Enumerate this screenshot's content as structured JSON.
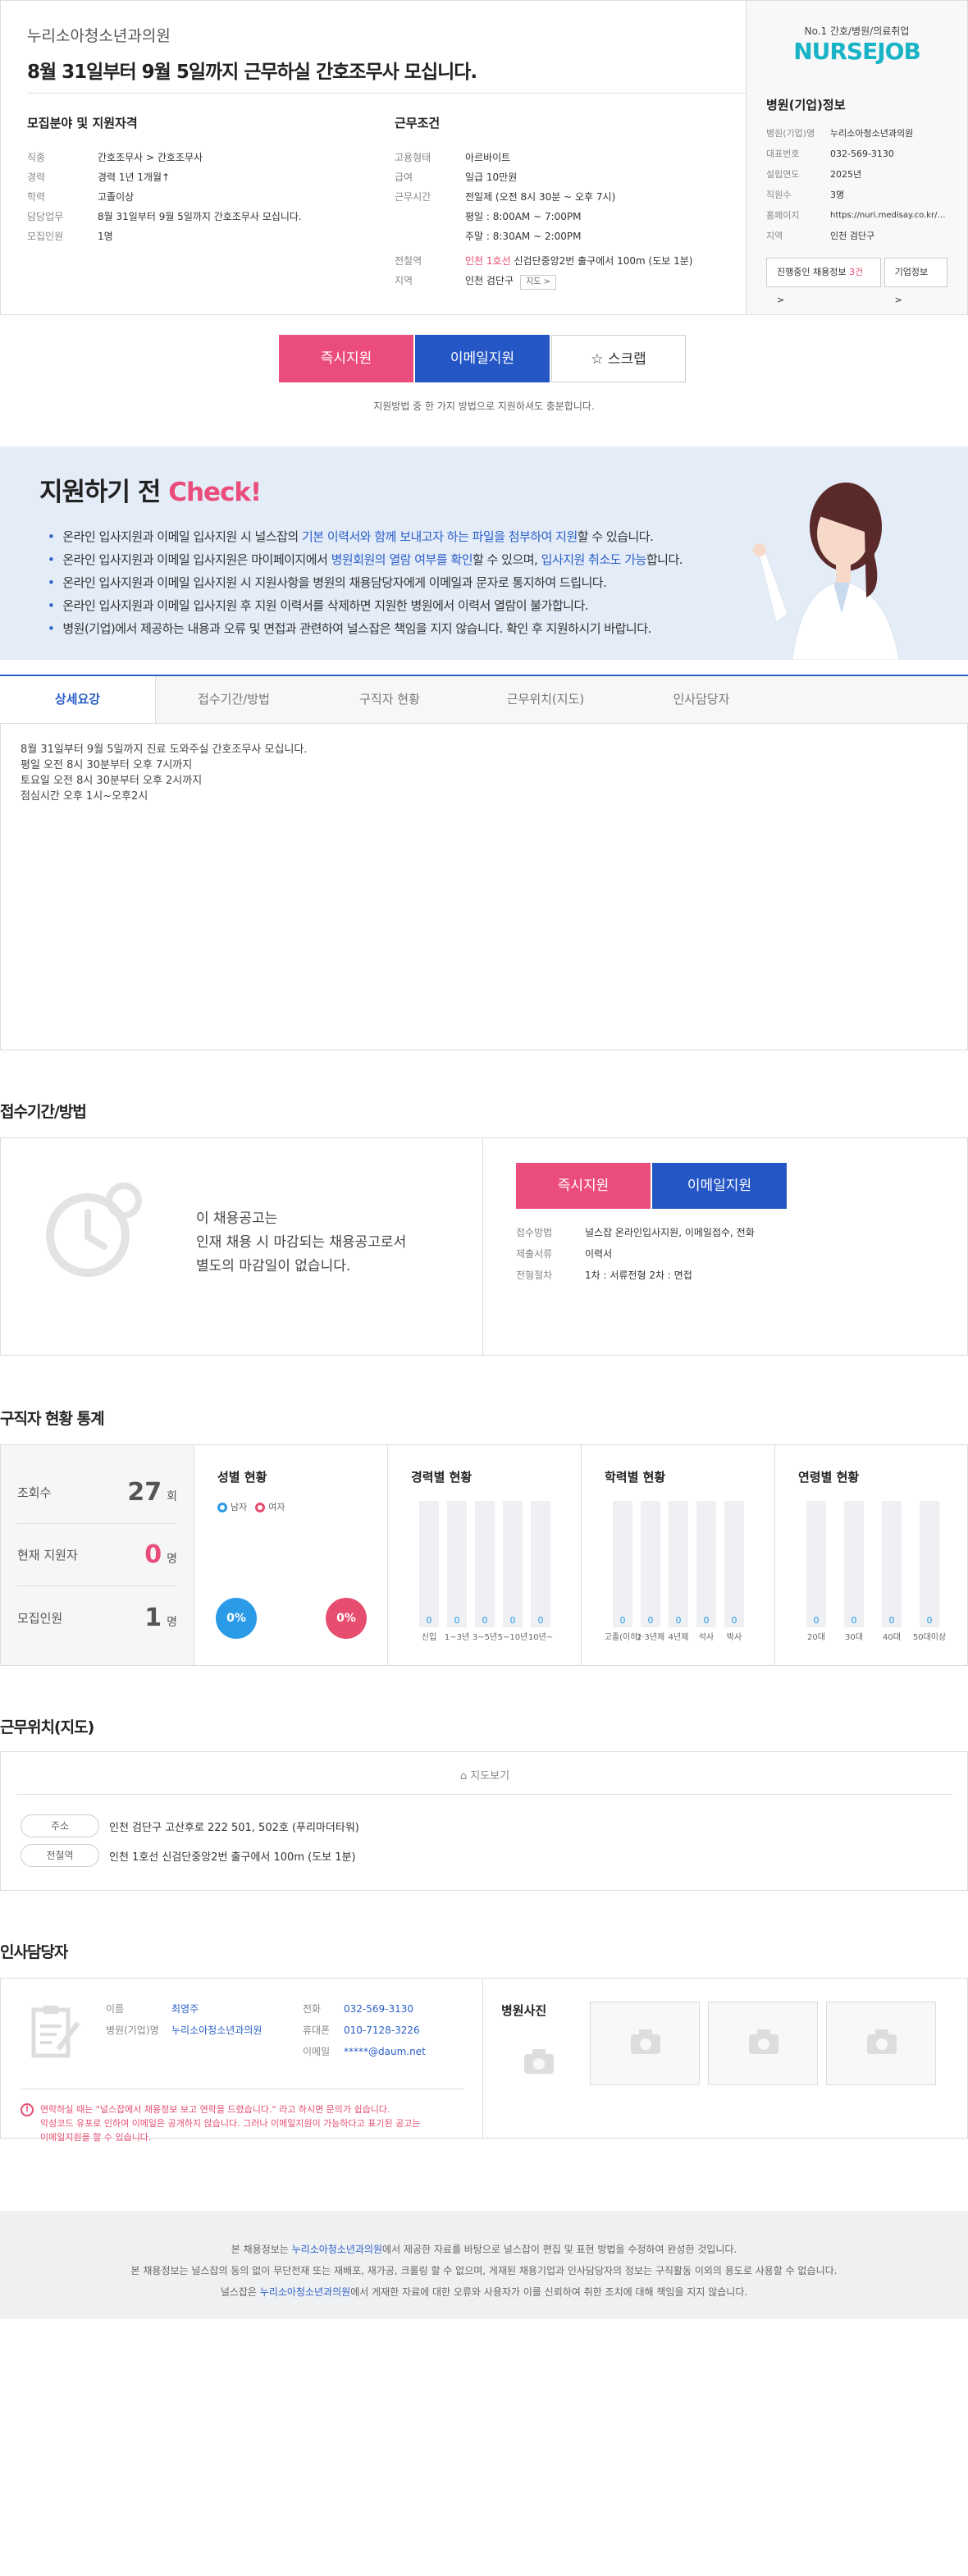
{
  "header": {
    "company": "누리소아청소년과의원",
    "title": "8월 31일부터 9월 5일까지 근무하실 간호조무사 모십니다.",
    "field_heading": "모집분야 및 지원자격",
    "field_rows": [
      {
        "k": "직종",
        "v": "간호조무사 > 간호조무사"
      },
      {
        "k": "경력",
        "v": "경력 1년 1개월↑"
      },
      {
        "k": "학력",
        "v": "고졸이상"
      },
      {
        "k": "담당업무",
        "v": "8월 31일부터 9월 5일까지 간호조무사 모십니다."
      },
      {
        "k": "모집인원",
        "v": "1명"
      }
    ],
    "cond_heading": "근무조건",
    "cond_rows": {
      "type_k": "고용형태",
      "type_v": "아르바이트",
      "pay_k": "급여",
      "pay_v": "일급 10만원",
      "time_k": "근무시간",
      "time_v1": "전일제 (오전 8시 30분 ~ 오후 7시)",
      "time_v2": "평일 : 8:00AM ~ 7:00PM",
      "time_v3": "주말 : 8:30AM ~ 2:00PM",
      "sub_k": "전철역",
      "sub_line": "인천 1호선",
      "sub_v": "신검단중앙2번 출구에서 100m (도보 1분)",
      "area_k": "지역",
      "area_v": "인천 검단구",
      "map_btn": "지도 >"
    }
  },
  "side": {
    "brand_sub": "No.1 간호/병원/의료취업",
    "brand": "NURSEJOB",
    "heading": "병원(기업)정보",
    "rows": [
      {
        "k": "병원(기업)명",
        "v": "누리소아청소년과의원"
      },
      {
        "k": "대표번호",
        "v": "032-569-3130"
      },
      {
        "k": "설립연도",
        "v": "2025년"
      },
      {
        "k": "직원수",
        "v": "3명"
      },
      {
        "k": "홈페이지",
        "v": "https://nuri.medisay.co.kr/bui..."
      },
      {
        "k": "지역",
        "v": "인천 검단구"
      }
    ],
    "btn_jobs_a": "진행중인 채용정보 ",
    "btn_jobs_n": "3건",
    "btn_info": "기업정보 >"
  },
  "apply": {
    "now": "즉시지원",
    "email": "이메일지원",
    "scrap": "☆  스크랩",
    "note": "지원방법 중 한 가지 방법으로 지원하셔도 충분합니다."
  },
  "check": {
    "title_a": "지원하기 전 ",
    "title_b": "Check!",
    "l1a": "온라인 입사지원과 이메일 입사지원 시 널스잡의 ",
    "l1b": "기본 이력서와 함께 보내고자 하는 파일을 첨부하여 지원",
    "l1c": "할 수 있습니다.",
    "l2a": "온라인 입사지원과 이메일 입사지원은 마이페이지에서 ",
    "l2b": "병원회원의 열람 여부를 확인",
    "l2c": "할 수 있으며, ",
    "l2d": "입사지원 취소도 가능",
    "l2e": "합니다.",
    "l3": "온라인 입사지원과 이메일 입사지원 시 지원사항을 병원의 채용담당자에게 이메일과 문자로 통지하여 드립니다.",
    "l4": "온라인 입사지원과 이메일 입사지원 후 지원 이력서를 삭제하면 지원한 병원에서 이력서 열람이 불가합니다.",
    "l5": "병원(기업)에서 제공하는 내용과 오류 및 면접과 관련하여 널스잡은 책임을 지지 않습니다. 확인 후 지원하시기 바랍니다."
  },
  "tabs": [
    "상세요강",
    "접수기간/방법",
    "구직자 현황",
    "근무위치(지도)",
    "인사담당자"
  ],
  "detail": {
    "l1": "8월 31일부터  9월 5일까지 진료 도와주실 간호조무사 모십니다.",
    "l2": "평일 오전 8시 30분부터 오후 7시까지",
    "l3": "토요일 오전 8시 30분부터 오후 2시까지",
    "l4": "점심시간 오후 1시~오후2시"
  },
  "receive": {
    "title": "접수기간/방법",
    "msg1": "이 채용공고는",
    "msg2": "인재 채용 시 마감되는 채용공고로서",
    "msg3": "별도의 마감일이 없습니다.",
    "btn_now": "즉시지원",
    "btn_email": "이메일지원",
    "rows": [
      {
        "k": "접수방법",
        "v": "널스잡 온라인입사지원, 이메일접수, 전화"
      },
      {
        "k": "제출서류",
        "v": "이력서"
      },
      {
        "k": "전형절차",
        "v": "1차 : 서류전형    2차 : 면접"
      }
    ]
  },
  "stats": {
    "title": "구직자 현황 통계",
    "views_k": "조회수",
    "views_n": "27",
    "views_u": "회",
    "applicants_k": "현재 지원자",
    "applicants_n": "0",
    "applicants_u": "명",
    "recruit_k": "모집인원",
    "recruit_n": "1",
    "recruit_u": "명",
    "gender_h": "성별 현황",
    "male": "남자",
    "female": "여자",
    "male_pct": "0%",
    "female_pct": "0%",
    "career_h": "경력별 현황",
    "edu_h": "학력별 현황",
    "age_h": "연령별 현황"
  },
  "chart_data": [
    {
      "type": "bar",
      "title": "경력별 현황",
      "categories": [
        "신입",
        "1~3년",
        "3~5년",
        "5~10년",
        "10년~"
      ],
      "values": [
        0,
        0,
        0,
        0,
        0
      ]
    },
    {
      "type": "bar",
      "title": "학력별 현황",
      "categories": [
        "고졸(이하)",
        "2·3년제",
        "4년제",
        "석사",
        "박사"
      ],
      "values": [
        0,
        0,
        0,
        0,
        0
      ]
    },
    {
      "type": "bar",
      "title": "연령별 현황",
      "categories": [
        "20대",
        "30대",
        "40대",
        "50대이상"
      ],
      "values": [
        0,
        0,
        0,
        0
      ]
    }
  ],
  "map": {
    "title": "근무위치(지도)",
    "btn": "지도보기",
    "addr_k": "주소",
    "addr_v": "인천 검단구 고산후로 222 501, 502호 (푸리마더타워)",
    "sub_k": "전철역",
    "sub_v": "인천 1호선 신검단중앙2번 출구에서 100m (도보 1분)"
  },
  "contact": {
    "title": "인사담당자",
    "name_k": "이름",
    "name_v": "최영주",
    "org_k": "병원(기업)명",
    "org_v": "누리소아청소년과의원",
    "tel_k": "전화",
    "tel_v": "032-569-3130",
    "mobile_k": "휴대폰",
    "mobile_v": "010-7128-3226",
    "email_k": "이메일",
    "email_v": "*****@daum.net",
    "warn1": "연락하실 때는 \"널스잡에서 채용정보 보고 연락을 드렸습니다.\" 라고 하시면 문의가 쉽습니다.",
    "warn2": "악성코드 유포로 인하여 이메일은 공개하지 않습니다. 그러나 이메일지원이 가능하다고 표기된 공고는",
    "warn3": "이메일지원을 할 수 있습니다.",
    "photos_h": "병원사진"
  },
  "footer": {
    "l1a": "본 채용정보는 ",
    "l1b": "누리소아청소년과의원",
    "l1c": "에서 제공한 자료를 바탕으로 널스잡이 편집 및 표현 방법을 수정하여 완성한 것입니다.",
    "l2": "본 채용정보는 널스잡의 동의 없이 무단전재 또는 재배포, 재가공, 크롤링 할 수 없으며, 게재된 채용기업과 인사담당자의 정보는 구직활동 이외의 용도로 사용할 수 없습니다.",
    "l3a": "널스잡은 ",
    "l3b": "누리소아청소년과의원",
    "l3c": "에서 게재한 자료에 대한 오류와 사용자가 이를 신뢰하여 취한 조치에 대해 책임을 지지 않습니다."
  }
}
